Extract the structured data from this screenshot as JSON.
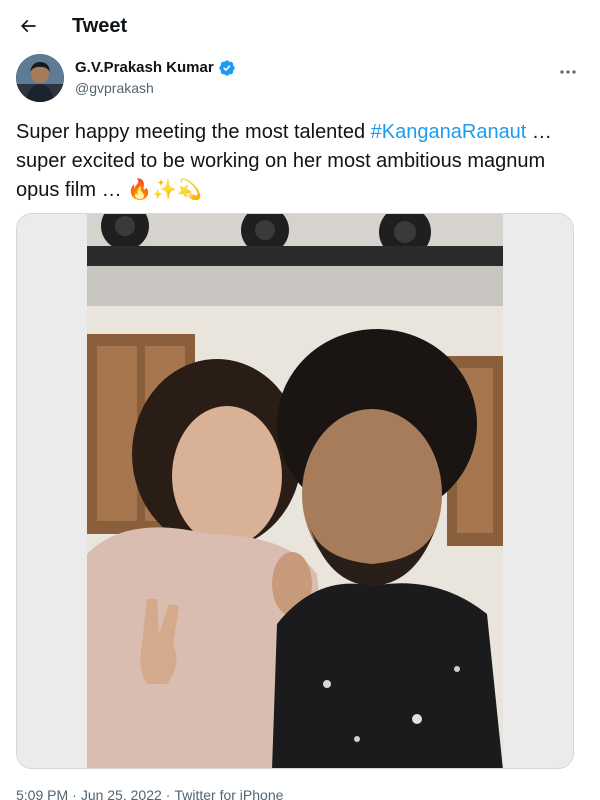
{
  "header": {
    "title": "Tweet",
    "back_icon": "back-arrow-icon"
  },
  "author": {
    "display_name": "G.V.Prakash Kumar",
    "handle": "@gvprakash",
    "verified": true,
    "verified_color": "#1d9bf0"
  },
  "tweet": {
    "text_before": "Super happy meeting the most talented ",
    "hashtag": "#KanganaRanaut",
    "text_after": " … super excited to be working on her most ambitious magnum opus film … ",
    "emojis": "🔥✨💫"
  },
  "media": {
    "description_icon": "photo-image"
  },
  "meta": {
    "time": "5:09 PM",
    "separator": "·",
    "date": "Jun 25, 2022",
    "source": "Twitter for iPhone"
  },
  "colors": {
    "link": "#1d9bf0",
    "secondary_text": "#536471",
    "border": "#cfd9de"
  }
}
